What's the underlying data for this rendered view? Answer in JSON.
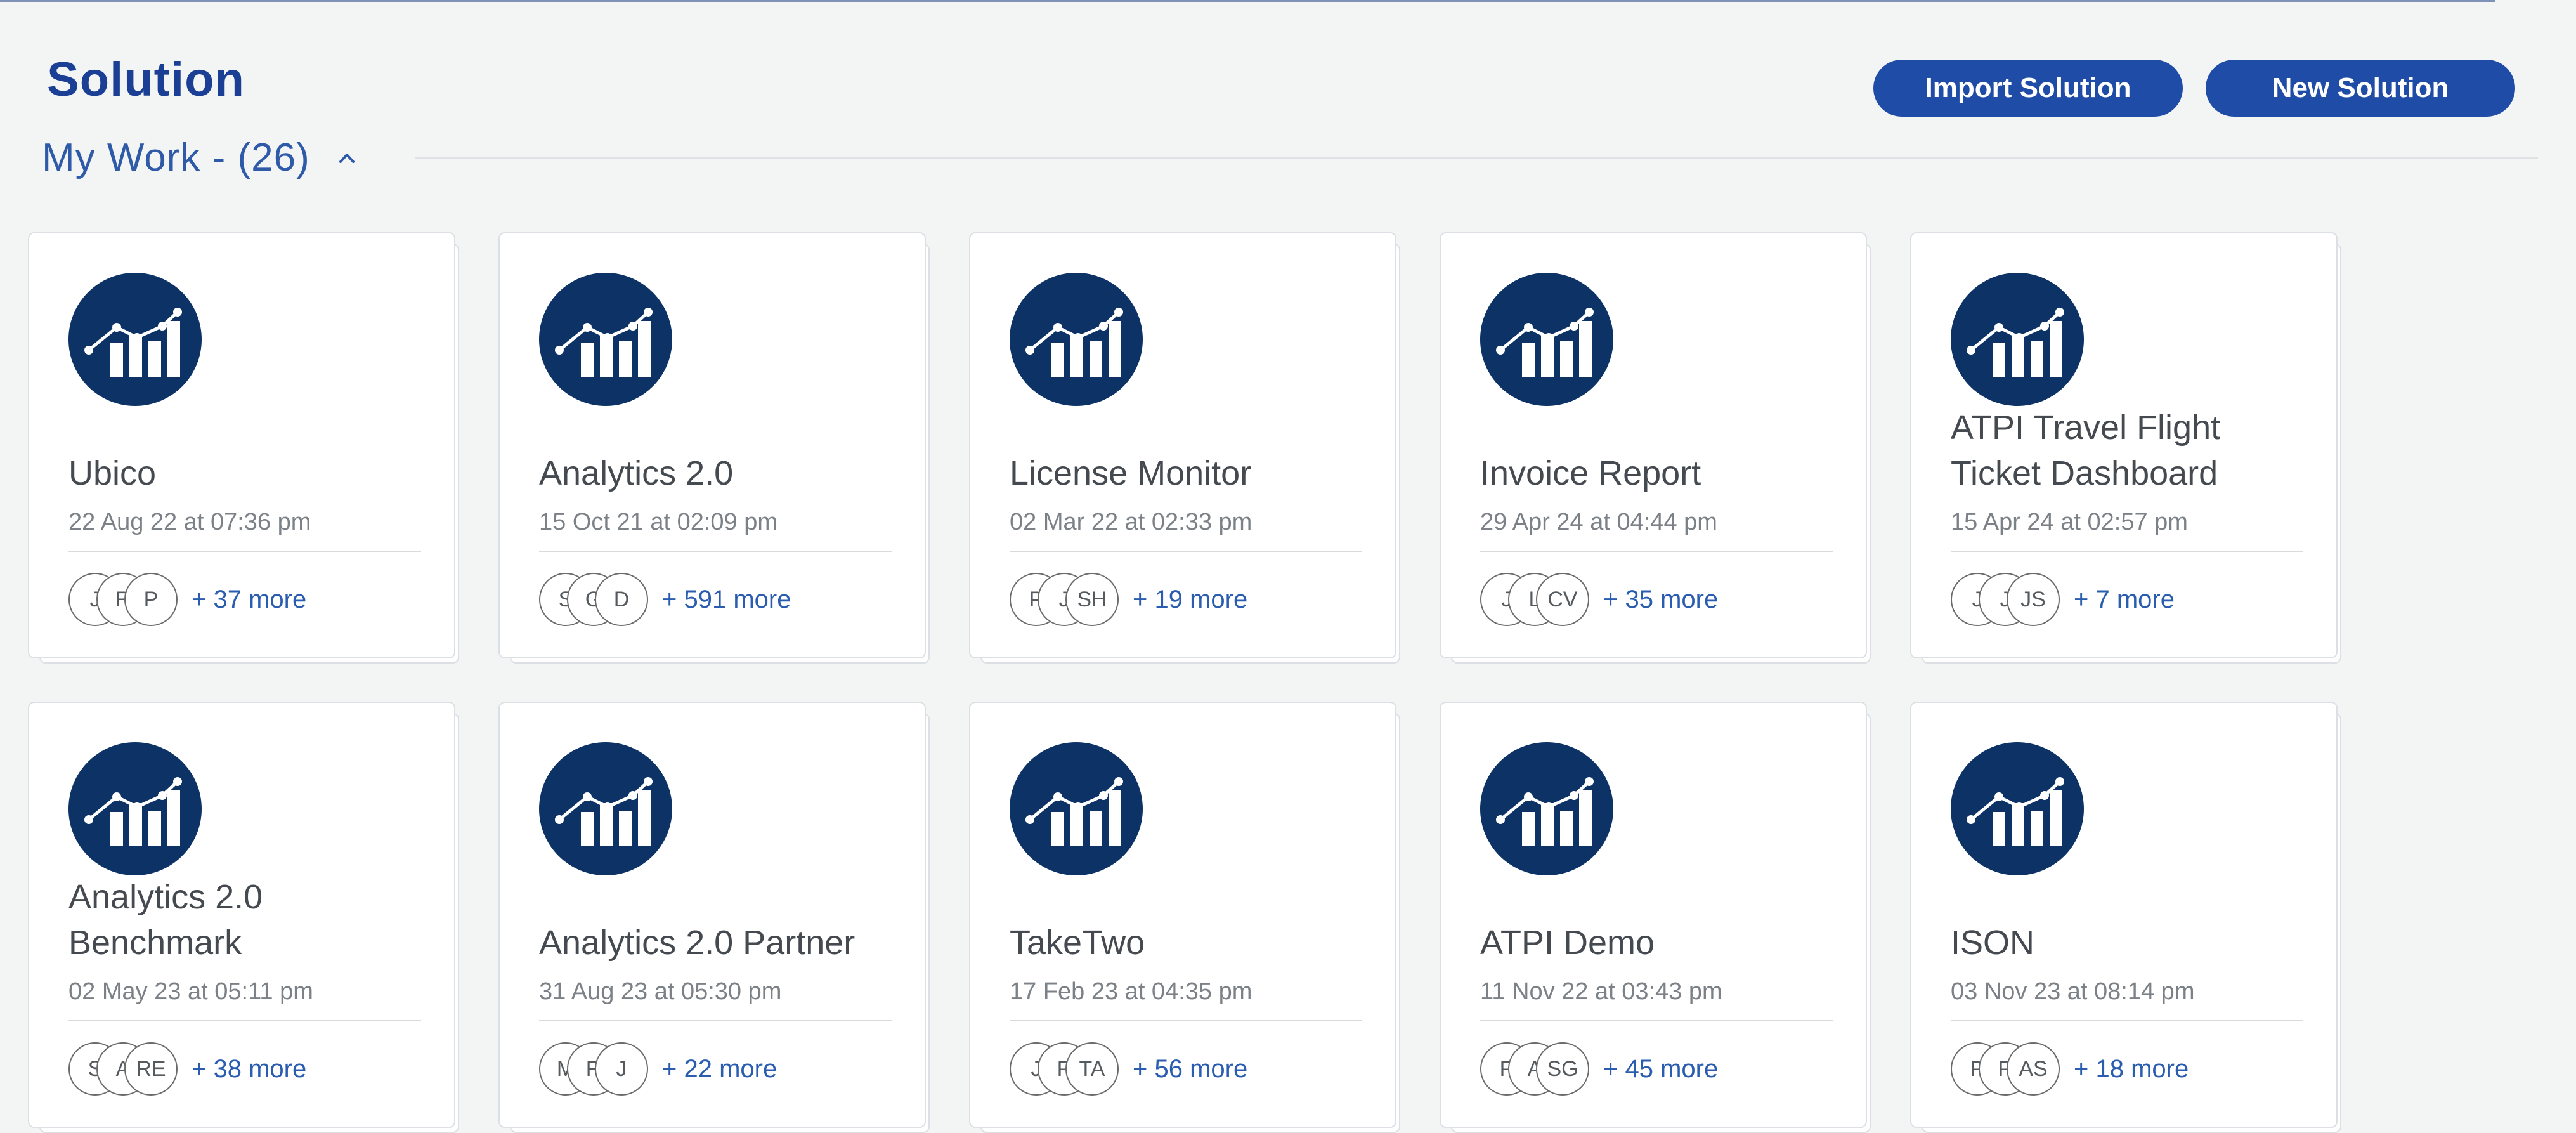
{
  "page": {
    "title": "Solution",
    "import_label": "Import Solution",
    "new_label": "New Solution"
  },
  "section": {
    "label": "My Work - (26)"
  },
  "colors": {
    "brand": "#1f4ca6",
    "title": "#1a3f94",
    "icon_bg": "#0c3266",
    "link": "#2a5db0"
  },
  "cards": [
    {
      "title": "Ubico",
      "date": "22 Aug 22 at 07:36 pm",
      "avatars": [
        "J",
        "R",
        "P"
      ],
      "more": "+ 37 more"
    },
    {
      "title": "Analytics 2.0",
      "date": "15 Oct 21 at 02:09 pm",
      "avatars": [
        "S",
        "G",
        "D"
      ],
      "more": "+ 591 more"
    },
    {
      "title": "License Monitor",
      "date": "02 Mar 22 at 02:33 pm",
      "avatars": [
        "P",
        "J",
        "SH"
      ],
      "more": "+ 19 more"
    },
    {
      "title": "Invoice Report",
      "date": "29 Apr 24 at 04:44 pm",
      "avatars": [
        "J",
        "L",
        "CV"
      ],
      "more": "+ 35 more"
    },
    {
      "title": "ATPI Travel Flight Ticket Dashboard",
      "date": "15 Apr 24 at 02:57 pm",
      "avatars": [
        "J",
        "J",
        "JS"
      ],
      "more": "+ 7 more"
    },
    {
      "title": "Analytics 2.0 Benchmark",
      "date": "02 May 23 at 05:11 pm",
      "avatars": [
        "S",
        "A",
        "RE"
      ],
      "more": "+ 38 more"
    },
    {
      "title": "Analytics 2.0 Partner",
      "date": "31 Aug 23 at 05:30 pm",
      "avatars": [
        "M",
        "R",
        "J"
      ],
      "more": "+ 22 more"
    },
    {
      "title": "TakeTwo",
      "date": "17 Feb 23 at 04:35 pm",
      "avatars": [
        "J",
        "P",
        "TA"
      ],
      "more": "+ 56 more"
    },
    {
      "title": "ATPI Demo",
      "date": "11 Nov 22 at 03:43 pm",
      "avatars": [
        "P",
        "A",
        "SG"
      ],
      "more": "+ 45 more"
    },
    {
      "title": "ISON",
      "date": "03 Nov 23 at 08:14 pm",
      "avatars": [
        "P",
        "P",
        "AS"
      ],
      "more": "+ 18 more"
    }
  ]
}
